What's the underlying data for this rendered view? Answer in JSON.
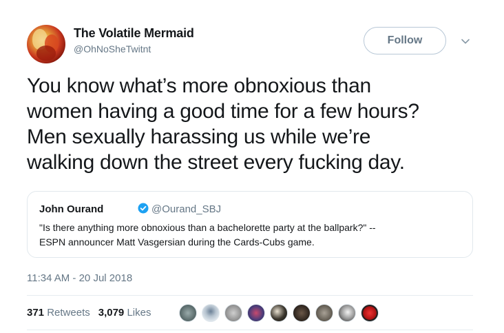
{
  "author": {
    "display_name": "The Volatile Mermaid",
    "handle": "@OhNoSheTwitnt",
    "avatar_icon": "avatar-flame"
  },
  "follow_button": {
    "label": "Follow"
  },
  "tweet": {
    "lines": [
      "You know what’s more obnoxious than",
      "women having a good time for a few hours?",
      "Men sexually harassing us while we’re",
      "walking down the street every fucking day."
    ]
  },
  "quoted_tweet": {
    "display_name": "John Ourand",
    "verified_icon": "verified-badge-icon",
    "handle": "@Ourand_SBJ",
    "lines": [
      "\"Is there anything more obnoxious than a bachelorette party at the ballpark?\" --",
      "ESPN announcer Matt Vasgersian during the Cards-Cubs game."
    ]
  },
  "timestamp": "11:34 AM - 20 Jul 2018",
  "stats": {
    "retweets_count": "371",
    "retweets_label": "Retweets",
    "likes_count": "3,079",
    "likes_label": "Likes"
  },
  "colors": {
    "text": "#14171a",
    "secondary": "#657786",
    "border": "#e1e8ed",
    "verified": "#1da1f2"
  }
}
